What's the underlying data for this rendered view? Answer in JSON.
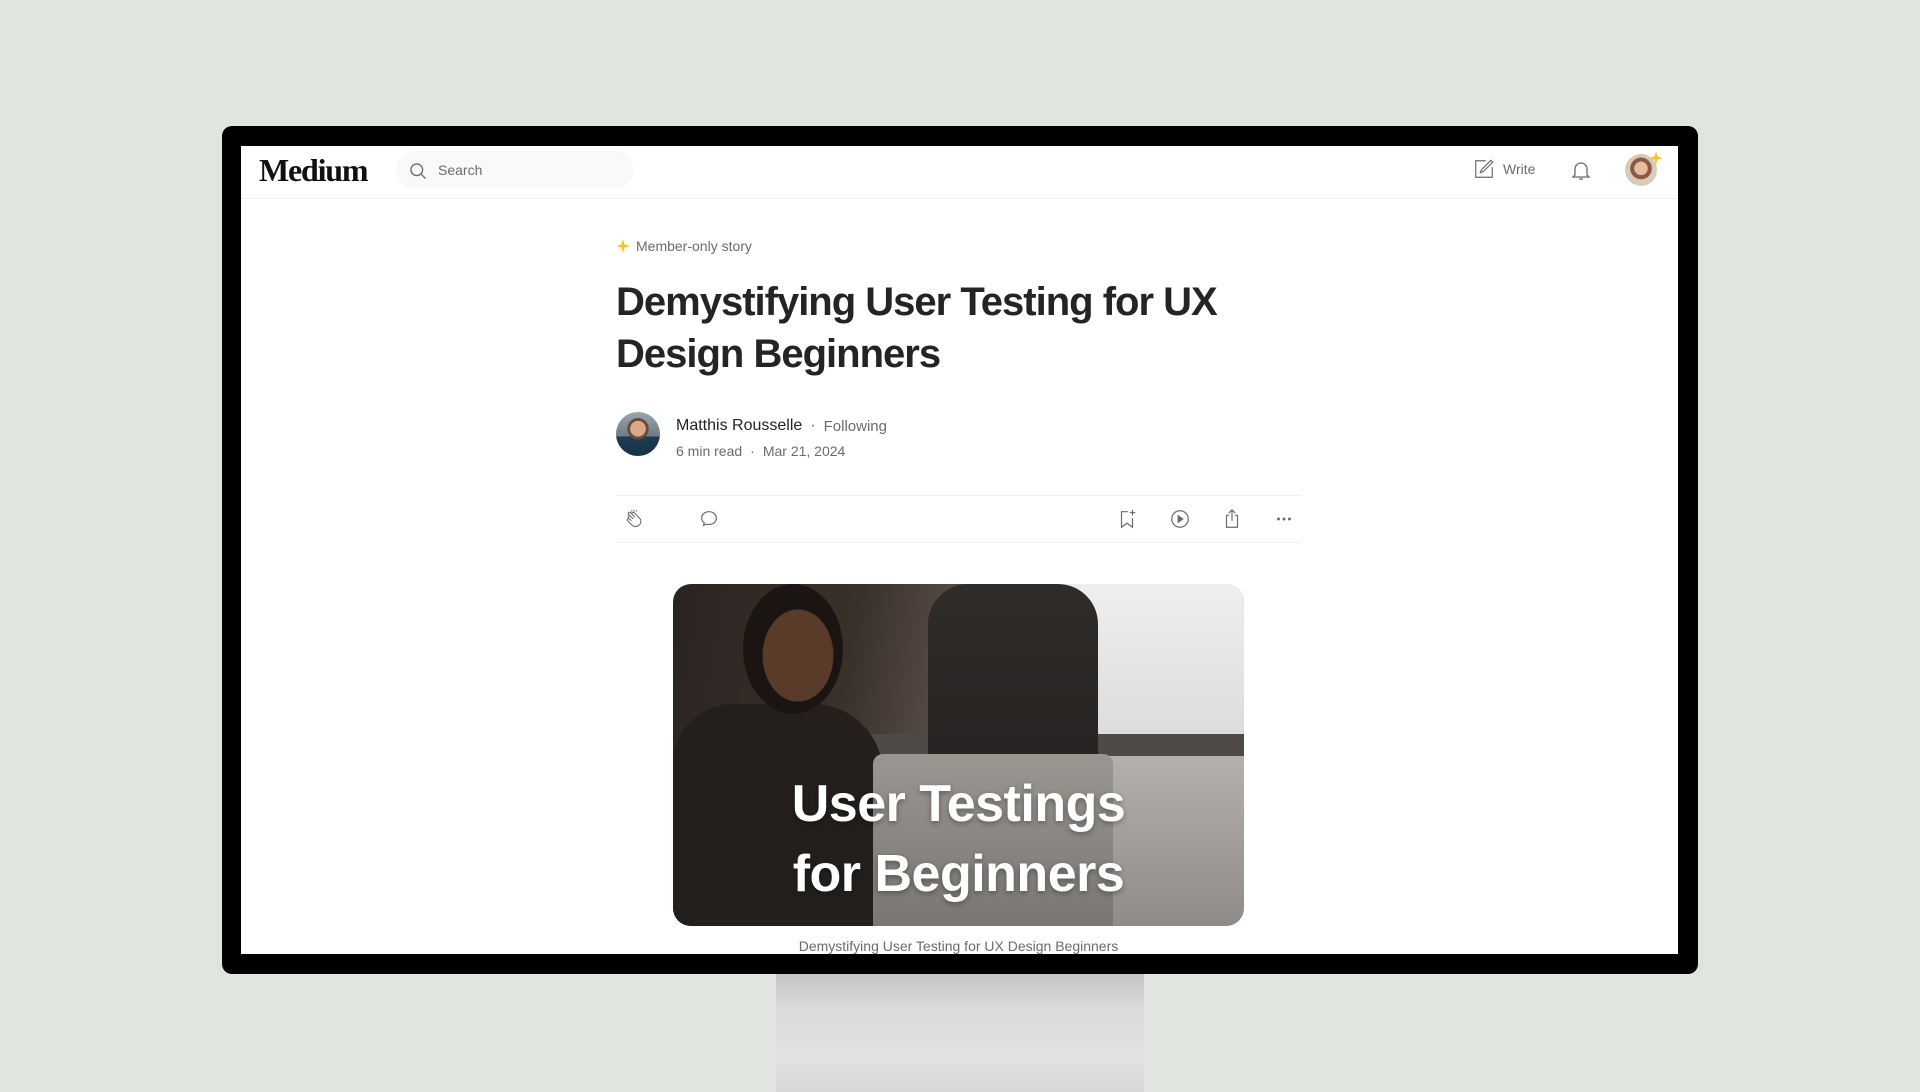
{
  "nav": {
    "logo": "Medium",
    "search_placeholder": "Search",
    "write_label": "Write",
    "icons": [
      "search-icon",
      "write-icon",
      "bell-icon",
      "avatar"
    ]
  },
  "article": {
    "member_label": "Member-only story",
    "title": "Demystifying User Testing for UX Design Beginners",
    "author": {
      "name": "Matthis Rousselle",
      "follow_status": "Following",
      "read_time": "6 min read",
      "date": "Mar 21, 2024"
    },
    "actions": {
      "left": [
        "clap-icon",
        "comment-icon"
      ],
      "right": [
        "bookmark-add-icon",
        "play-icon",
        "share-icon",
        "more-icon"
      ]
    },
    "hero": {
      "overlay_line1": "User Testings",
      "overlay_line2": "for Beginners",
      "caption": "Demystifying User Testing for UX Design Beginners"
    }
  },
  "colors": {
    "background": "#e0e5df",
    "text_primary": "#242424",
    "text_secondary": "#6b6b6b",
    "member_star": "#ffc017",
    "bezel": "#000000"
  }
}
